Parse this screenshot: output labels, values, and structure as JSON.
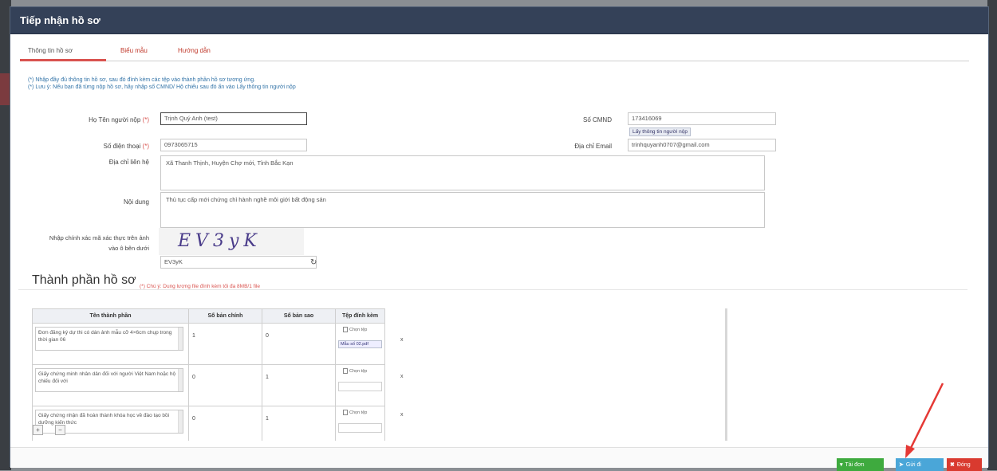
{
  "modal": {
    "title": "Tiếp nhận hồ sơ"
  },
  "tabs": [
    {
      "label": "Thông tin hồ sơ"
    },
    {
      "label": "Biểu mẫu"
    },
    {
      "label": "Hướng dẫn"
    }
  ],
  "notices": [
    "(*) Nhập đầy đủ thông tin hồ sơ, sau đó đính kèm các tệp vào thành phần hồ sơ tương ứng.",
    "(*) Lưu ý: Nếu bạn đã từng nộp hồ sơ, hãy nhập số CMND/ Hộ chiếu sau đó ấn vào Lấy thông tin người nộp"
  ],
  "form": {
    "required_mark": "(*)",
    "fullname_label": "Họ Tên người nộp",
    "fullname_value": "Trịnh Quý Anh (test)",
    "cmnd_label": "Số CMND",
    "cmnd_value": "173416069",
    "get_info_link": "Lấy thông tin người nộp",
    "phone_label": "Số điện thoại",
    "phone_value": "0973065715",
    "email_label": "Địa chỉ Email",
    "email_value": "trinhquyanh0707@gmail.com",
    "address_label": "Địa chỉ liên hệ",
    "address_value": "Xã Thanh Thịnh, Huyện Chợ mới, Tỉnh Bắc Kạn",
    "content_label": "Nội dung",
    "content_value": "Thủ tục cấp mới chứng chỉ hành nghề môi giới bất động sản",
    "captcha_label": "Nhập chính xác mã xác thực trên ảnh vào ô bên dưới",
    "captcha_image_text": "EV3yK",
    "captcha_value": "EV3yK"
  },
  "section": {
    "title": "Thành phần hồ sơ",
    "note": "(*) Chú ý: Dung lượng file đính kèm tối đa 8MB/1 file"
  },
  "table": {
    "headers": [
      "Tên thành phần",
      "Số bản chính",
      "Số bản sao",
      "Tệp đính kèm"
    ],
    "choose_file_label": "Chọn tệp",
    "rows": [
      {
        "name": "Đơn đăng ký dự thi có dán ảnh mẫu cỡ 4×6cm chụp trong thời gian 06",
        "original": "1",
        "copy": "0",
        "sample": "Mẫu số 02.pdf",
        "remove": "x"
      },
      {
        "name": "Giấy chứng minh nhân dân đối với người Việt Nam hoặc hộ chiếu đối với",
        "original": "0",
        "copy": "1",
        "sample": "",
        "remove": "x"
      },
      {
        "name": "Giấy chứng nhận đã hoàn thành khóa học về đào tạo bồi dưỡng kiến thức",
        "original": "0",
        "copy": "1",
        "sample": "",
        "remove": "x"
      }
    ]
  },
  "buttons": {
    "download": "Tải đơn",
    "send": "Gửi đi",
    "close": "Đóng"
  },
  "colors": {
    "header_bg": "#344158",
    "tab_active_underline": "#d9534f",
    "btn_green": "#3eaa3e",
    "btn_blue": "#4aa6d8",
    "btn_red": "#d93a2f",
    "annotation_arrow": "#e53935"
  }
}
